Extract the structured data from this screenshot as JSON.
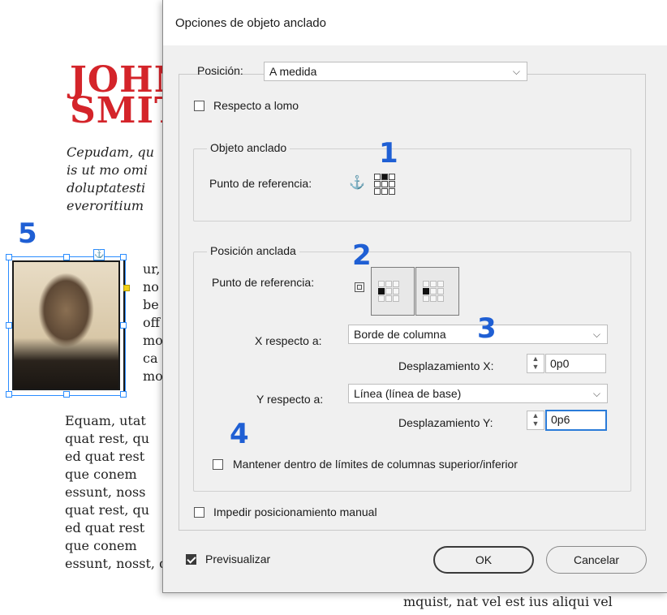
{
  "document": {
    "title_lines": [
      "JOHN",
      "SMIT"
    ],
    "intro_lines": [
      "Cepudam, qu",
      "is ut mo omi",
      "doluptatesti",
      "everoritium"
    ],
    "short_lines": [
      "ur,",
      "no",
      "be",
      "off",
      "mo",
      "ca",
      "mo"
    ],
    "body_lines": [
      "Equam, utat",
      "quat rest, qu",
      "ed quat rest",
      "que conem",
      "essunt, noss",
      "quat rest, qu",
      "ed quat rest",
      "que conem",
      "essunt, nosst, quae et que num"
    ],
    "right_text": "mquist, nat vel est ius aliqui vel"
  },
  "callouts": {
    "c1": "1",
    "c2": "2",
    "c3": "3",
    "c4": "4",
    "c5": "5"
  },
  "dialog": {
    "title": "Opciones de objeto anclado",
    "position_label": "Posición:",
    "position_value": "A medida",
    "relative_spine_label": "Respecto a lomo",
    "relative_spine_checked": false,
    "anchored_object": {
      "group_label": "Objeto anclado",
      "ref_point_label": "Punto de referencia:",
      "selected_point": "top-center"
    },
    "anchored_position": {
      "group_label": "Posición anclada",
      "ref_point_label": "Punto de referencia:",
      "selected_point": "middle-left",
      "x_relative_label": "X respecto a:",
      "x_relative_value": "Borde de columna",
      "x_offset_label": "Desplazamiento X:",
      "x_offset_value": "0p0",
      "y_relative_label": "Y respecto a:",
      "y_relative_value": "Línea (línea de base)",
      "y_offset_label": "Desplazamiento Y:",
      "y_offset_value": "0p6",
      "keep_within_label": "Mantener dentro de límites de columnas superior/inferior",
      "keep_within_checked": false
    },
    "prevent_manual_label": "Impedir posicionamiento manual",
    "prevent_manual_checked": false,
    "preview_label": "Previsualizar",
    "preview_checked": true,
    "ok_label": "OK",
    "cancel_label": "Cancelar"
  },
  "colors": {
    "accent_callout": "#1f5fd4",
    "title_red": "#d4242a",
    "selection_blue": "#2a8cff"
  }
}
